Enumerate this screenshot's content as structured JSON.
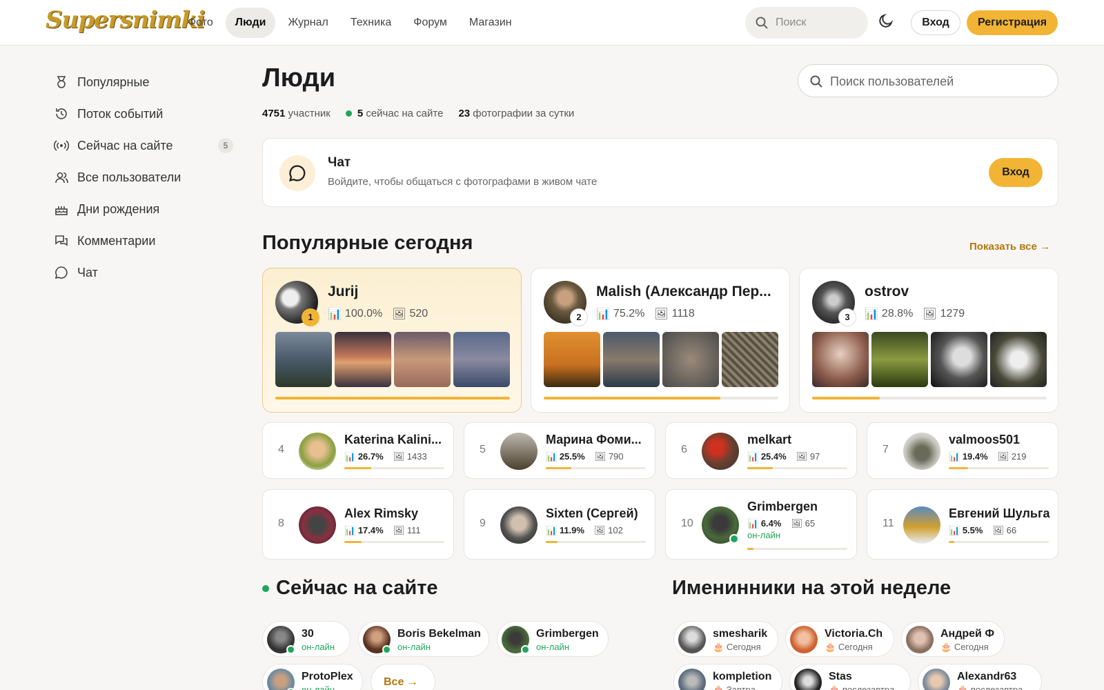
{
  "header": {
    "logo": "Supersnimki",
    "nav": [
      "Фото",
      "Люди",
      "Журнал",
      "Техника",
      "Форум",
      "Магазин"
    ],
    "active_nav": "Люди",
    "search_placeholder": "Поиск",
    "login": "Вход",
    "register": "Регистрация"
  },
  "sidebar": {
    "items": [
      {
        "label": "Популярные",
        "icon": "medal-icon"
      },
      {
        "label": "Поток событий",
        "icon": "history-icon"
      },
      {
        "label": "Сейчас на сайте",
        "icon": "broadcast-icon",
        "badge": "5"
      },
      {
        "label": "Все пользователи",
        "icon": "users-icon"
      },
      {
        "label": "Дни рождения",
        "icon": "cake-icon"
      },
      {
        "label": "Комментарии",
        "icon": "comments-icon"
      },
      {
        "label": "Чат",
        "icon": "chat-icon"
      }
    ]
  },
  "main": {
    "title": "Люди",
    "search_placeholder": "Поиск пользователей",
    "stats": {
      "members_count": "4751",
      "members_label": "участник",
      "online_count": "5",
      "online_label": "сейчас на сайте",
      "photos_count": "23",
      "photos_label": "фотографии за сутки"
    },
    "chat": {
      "title": "Чат",
      "subtitle": "Войдите, чтобы общаться с фотографами в живом чате",
      "button": "Вход"
    },
    "popular_title": "Популярные сегодня",
    "show_all": "Показать все"
  },
  "top3": [
    {
      "rank": "1",
      "name": "Jurij",
      "percent": "100.0%",
      "photos": "520",
      "progress": 1.0
    },
    {
      "rank": "2",
      "name": "Malish (Александр Пер...",
      "percent": "75.2%",
      "photos": "1118",
      "progress": 0.752
    },
    {
      "rank": "3",
      "name": "ostrov",
      "percent": "28.8%",
      "photos": "1279",
      "progress": 0.288
    }
  ],
  "ranked": [
    {
      "rank": "4",
      "name": "Katerina Kalini...",
      "percent": "26.7%",
      "photos": "1433",
      "progress": 0.267
    },
    {
      "rank": "5",
      "name": "Марина Фоми...",
      "percent": "25.5%",
      "photos": "790",
      "progress": 0.255
    },
    {
      "rank": "6",
      "name": "melkart",
      "percent": "25.4%",
      "photos": "97",
      "progress": 0.254
    },
    {
      "rank": "7",
      "name": "valmoos501",
      "percent": "19.4%",
      "photos": "219",
      "progress": 0.194
    },
    {
      "rank": "8",
      "name": "Alex Rimsky",
      "percent": "17.4%",
      "photos": "111",
      "progress": 0.174
    },
    {
      "rank": "9",
      "name": "Sixten (Сергей)",
      "percent": "11.9%",
      "photos": "102",
      "progress": 0.119
    },
    {
      "rank": "10",
      "name": "Grimbergen",
      "percent": "6.4%",
      "photos": "65",
      "progress": 0.064,
      "status": "он-лайн"
    },
    {
      "rank": "11",
      "name": "Евгений Шульга",
      "percent": "5.5%",
      "photos": "66",
      "progress": 0.055
    }
  ],
  "online": {
    "title": "Сейчас на сайте",
    "users": [
      {
        "name": "30",
        "status": "он-лайн"
      },
      {
        "name": "Boris Bekelman",
        "status": "он-лайн"
      },
      {
        "name": "Grimbergen",
        "status": "он-лайн"
      },
      {
        "name": "ProtoPlex",
        "status": "он-лайн"
      }
    ],
    "all_button": "Все"
  },
  "birthdays": {
    "title": "Именинники на этой неделе",
    "users": [
      {
        "name": "smesharik",
        "when": "Сегодня"
      },
      {
        "name": "Victoria.Ch",
        "when": "Сегодня"
      },
      {
        "name": "Андрей Ф",
        "when": "Сегодня"
      },
      {
        "name": "kompletion",
        "when": "Завтра"
      },
      {
        "name": "Stas",
        "when": "послезавтра"
      },
      {
        "name": "Alexandr63",
        "when": "послезавтра"
      }
    ]
  },
  "colors": {
    "accent": "#f2b435",
    "online": "#1ea65a",
    "link": "#b5760c"
  }
}
